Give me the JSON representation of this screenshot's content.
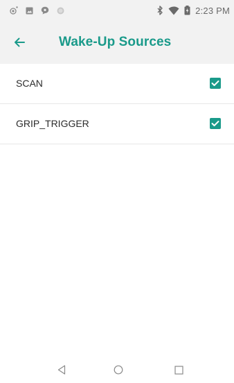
{
  "status_bar": {
    "time": "2:23 PM",
    "left_icons": [
      "notification-dot-icon",
      "photo-icon",
      "message-icon",
      "circle-icon"
    ],
    "right_icons": [
      "bluetooth-icon",
      "wifi-icon",
      "battery-icon"
    ]
  },
  "app_bar": {
    "back_icon": "arrow-back-icon",
    "title": "Wake-Up Sources"
  },
  "list": {
    "items": [
      {
        "label": "SCAN",
        "checked": true
      },
      {
        "label": "GRIP_TRIGGER",
        "checked": true
      }
    ]
  },
  "nav_bar": {
    "icons": [
      "back-triangle-icon",
      "home-circle-icon",
      "recents-square-icon"
    ]
  },
  "colors": {
    "accent": "#1a9a8a",
    "bar_background": "#f2f2f2"
  }
}
